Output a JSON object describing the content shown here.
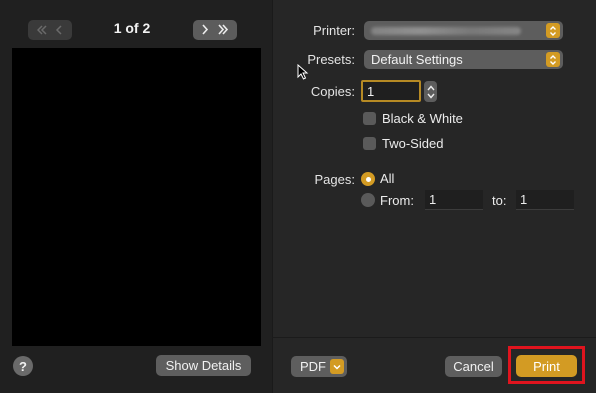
{
  "preview_nav": {
    "page_indicator": "1 of 2",
    "first_icon": "double-chevron-left",
    "prev_icon": "chevron-left",
    "next_icon": "chevron-right",
    "last_icon": "double-chevron-right"
  },
  "help_label": "?",
  "show_details_label": "Show Details",
  "printer": {
    "label": "Printer:",
    "value_icon": "redacted-text"
  },
  "presets": {
    "label": "Presets:",
    "value": "Default Settings"
  },
  "copies": {
    "label": "Copies:",
    "value": "1"
  },
  "black_white": {
    "label": "Black & White",
    "checked": false
  },
  "two_sided": {
    "label": "Two-Sided",
    "checked": false
  },
  "pages": {
    "label": "Pages:",
    "all_label": "All",
    "from_label": "From:",
    "from_value": "1",
    "to_label": "to:",
    "to_value": "1",
    "selected": "All"
  },
  "footer": {
    "pdf_label": "PDF",
    "cancel_label": "Cancel",
    "print_label": "Print"
  },
  "colors": {
    "accent": "#d39b23",
    "highlight": "#e0141e"
  }
}
